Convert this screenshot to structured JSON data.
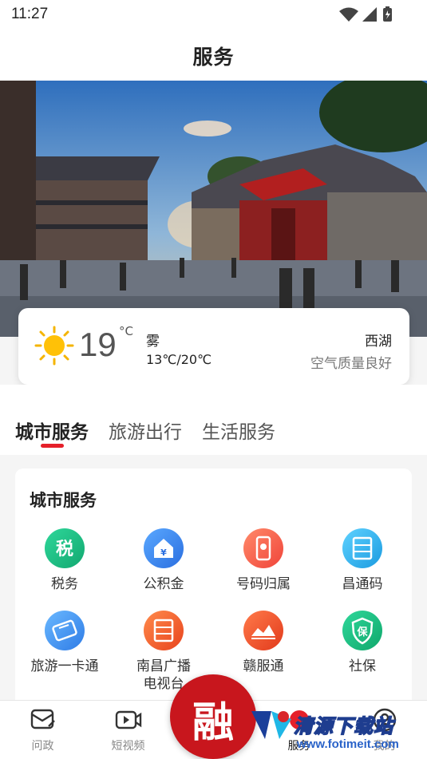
{
  "status_bar": {
    "time": "11:27"
  },
  "header": {
    "title": "服务"
  },
  "weather": {
    "temperature": "19",
    "unit": "°C",
    "condition": "雾",
    "range": "13℃/20℃",
    "location": "西湖",
    "air_quality": "空气质量良好"
  },
  "tabs": [
    {
      "label": "城市服务"
    },
    {
      "label": "旅游出行"
    },
    {
      "label": "生活服务"
    }
  ],
  "section": {
    "title": "城市服务",
    "items": [
      {
        "label": "税务",
        "icon": "tax-icon"
      },
      {
        "label": "公积金",
        "icon": "housing-fund-icon"
      },
      {
        "label": "号码归属",
        "icon": "phone-location-icon"
      },
      {
        "label": "昌通码",
        "icon": "changtong-code-icon"
      },
      {
        "label": "旅游一卡通",
        "icon": "travel-card-icon"
      },
      {
        "label": "南昌广播电视台",
        "icon": "tv-station-icon"
      },
      {
        "label": "赣服通",
        "icon": "ganfutong-icon"
      },
      {
        "label": "社保",
        "icon": "social-security-icon"
      }
    ]
  },
  "bottom_nav": [
    {
      "label": "问政",
      "icon": "inquiry-icon"
    },
    {
      "label": "短视频",
      "icon": "video-icon"
    },
    {
      "label": "服务",
      "icon": "service-icon"
    },
    {
      "label": "我的",
      "icon": "profile-icon"
    }
  ],
  "fab": {
    "glyph": "融"
  },
  "watermark": {
    "title": "清源下载站",
    "url": "www.fotimeit.com"
  },
  "colors": {
    "accent": "#e5202a",
    "fab": "#c8161d"
  }
}
